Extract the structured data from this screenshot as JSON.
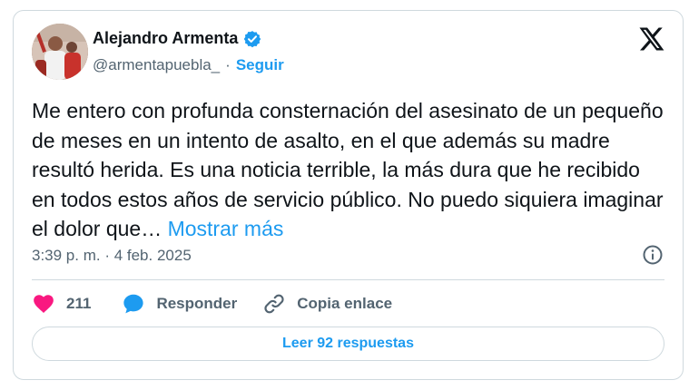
{
  "author": {
    "name": "Alejandro Armenta",
    "handle": "@armentapuebla_",
    "separator": "·",
    "follow_label": "Seguir",
    "verified_icon": "verified-badge-icon",
    "avatar_icon": "avatar"
  },
  "brand": {
    "logo_icon": "x-logo-icon",
    "accent": "#1d9bf0",
    "like_color": "#f91880"
  },
  "tweet": {
    "text": "Me entero con profunda consternación del asesinato de un pequeño de meses en un intento de asalto, en el que además su madre resultó herida. Es una noticia terrible, la más dura que he recibido en todos estos años de servicio público. No puedo siquiera imaginar el dolor que…",
    "show_more_label": "Mostrar más",
    "timestamp": "3:39 p. m. · 4 feb. 2025",
    "info_icon": "info-icon"
  },
  "actions": {
    "like_count": "211",
    "like_icon": "heart-icon",
    "reply_label": "Responder",
    "reply_icon": "speech-bubble-icon",
    "copy_label": "Copia enlace",
    "copy_icon": "link-icon"
  },
  "footer": {
    "replies_label": "Leer 92 respuestas"
  }
}
